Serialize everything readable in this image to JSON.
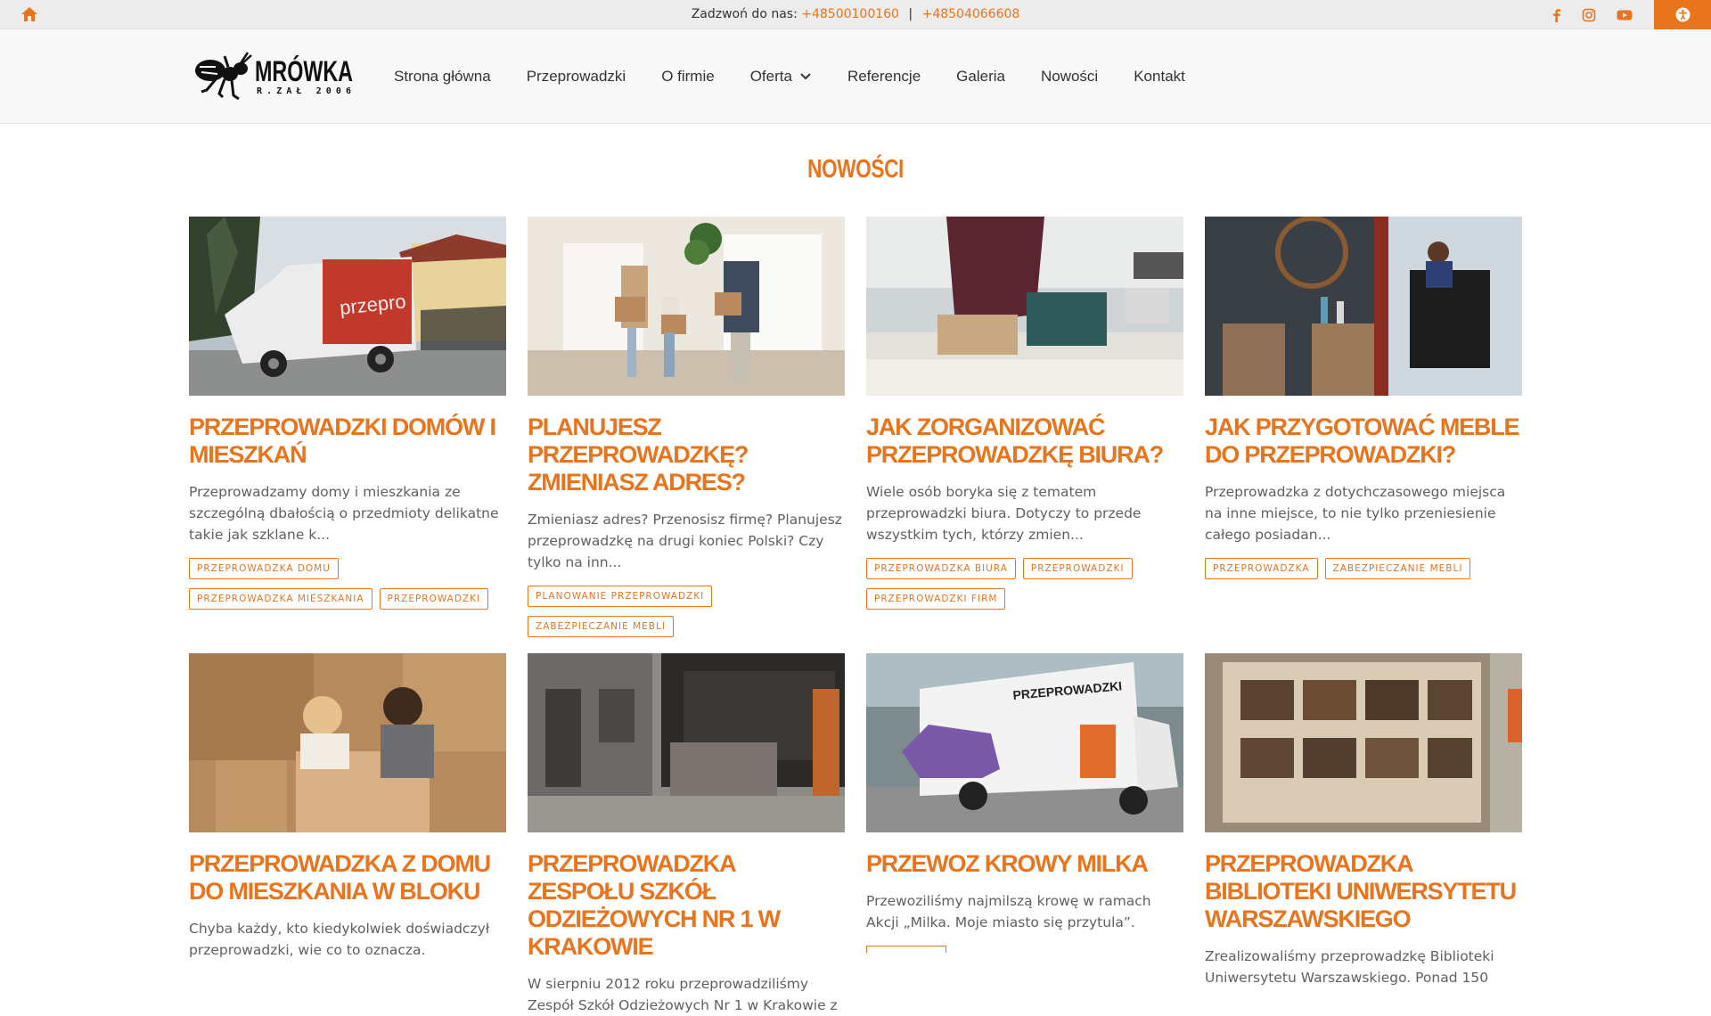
{
  "topbar": {
    "phone_label": "Zadzwoń do nas:",
    "phone1": "+48500100160",
    "separator": "|",
    "phone2": "+48504066608"
  },
  "logo": {
    "name": "MRÓWKA",
    "sub": "R.ZAŁ 2006"
  },
  "nav": [
    {
      "label": "Strona główna"
    },
    {
      "label": "Przeprowadzki"
    },
    {
      "label": "O firmie"
    },
    {
      "label": "Oferta"
    },
    {
      "label": "Referencje"
    },
    {
      "label": "Galeria"
    },
    {
      "label": "Nowości"
    },
    {
      "label": "Kontakt"
    }
  ],
  "page_title": "NOWOŚCI",
  "posts": [
    {
      "title": "PRZEPROWADZKI DOMÓW I MIESZKAŃ",
      "excerpt": "Przeprowadzamy domy i mieszkania ze szczególną dbałością o przedmioty delikatne takie jak szklane k...",
      "tags": [
        "PRZEPROWADZKA DOMU",
        "PRZEPROWADZKA MIESZKANIA",
        "PRZEPROWADZKI"
      ]
    },
    {
      "title": "PLANUJESZ PRZEPROWADZKĘ? ZMIENIASZ ADRES?",
      "excerpt": "Zmieniasz adres? Przenosisz firmę? Planujesz przeprowadzkę na drugi koniec Polski? Czy tylko na inn...",
      "tags": [
        "PLANOWANIE PRZEPROWADZKI",
        "ZABEZPIECZANIE MEBLI"
      ]
    },
    {
      "title": "JAK ZORGANIZOWAĆ PRZEPROWADZKĘ BIURA?",
      "excerpt": "Wiele osób boryka się z tematem przeprowadzki biura. Dotyczy to przede wszystkim tych, którzy zmien...",
      "tags": [
        "PRZEPROWADZKA BIURA",
        "PRZEPROWADZKI",
        "PRZEPROWADZKI FIRM"
      ]
    },
    {
      "title": "JAK PRZYGOTOWAĆ MEBLE DO PRZEPROWADZKI?",
      "excerpt": "Przeprowadzka z dotychczasowego miejsca na inne miejsce, to nie tylko przeniesienie całego posiadan...",
      "tags": [
        "PRZEPROWADZKA",
        "ZABEZPIECZANIE MEBLI"
      ]
    },
    {
      "title": "PRZEPROWADZKA Z DOMU DO MIESZKANIA W BLOKU",
      "excerpt": "Chyba każdy, kto kiedykolwiek doświadczył przeprowadzki, wie co to oznacza.",
      "tags": []
    },
    {
      "title": "PRZEPROWADZKA ZESPOŁU SZKÓŁ ODZIEŻOWYCH NR 1 W KRAKOWIE",
      "excerpt": "W sierpniu 2012 roku przeprowadziliśmy Zespół Szkół Odzieżowych Nr 1 w Krakowie z",
      "tags": []
    },
    {
      "title": "PRZEWOZ KROWY MILKA",
      "excerpt": "Przewoziliśmy najmilszą krowę w ramach Akcji „Milka. Moje miasto się przytula”.",
      "tags": []
    },
    {
      "title": "PRZEPROWADZKA BIBLIOTEKI UNIWERSYTETU WARSZAWSKIEGO",
      "excerpt": "Zrealizowaliśmy przeprowadzkę Biblioteki Uniwersytetu Warszawskiego. Ponad 150",
      "tags": []
    }
  ]
}
